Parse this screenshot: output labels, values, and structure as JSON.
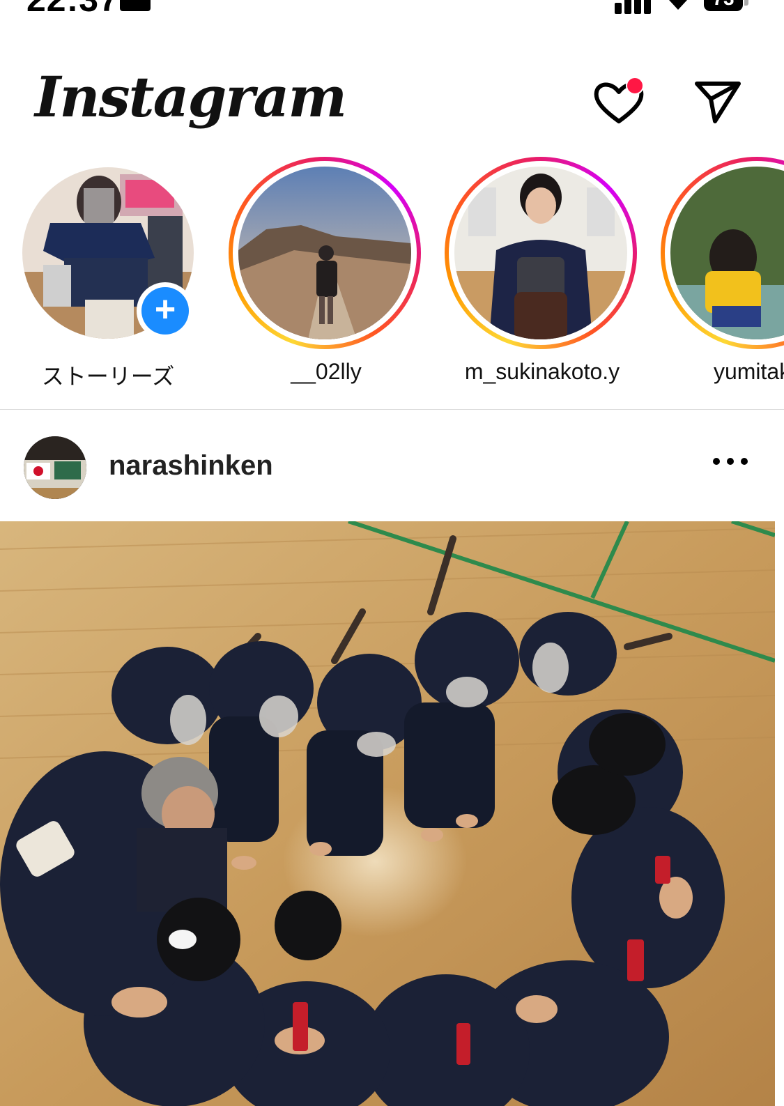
{
  "status_bar": {
    "time": "22:37",
    "battery": "73"
  },
  "header": {
    "logo": "Instagram",
    "has_notification": true
  },
  "stories": {
    "own": {
      "label": "ストーリーズ"
    },
    "items": [
      {
        "label": "__02lly"
      },
      {
        "label": "m_sukinakoto.y"
      },
      {
        "label": "yumitako"
      }
    ]
  },
  "post": {
    "username": "narashinken"
  },
  "colors": {
    "notification": "#ff1744",
    "add_story": "#1a8cff",
    "divider": "#dbdbdb"
  }
}
